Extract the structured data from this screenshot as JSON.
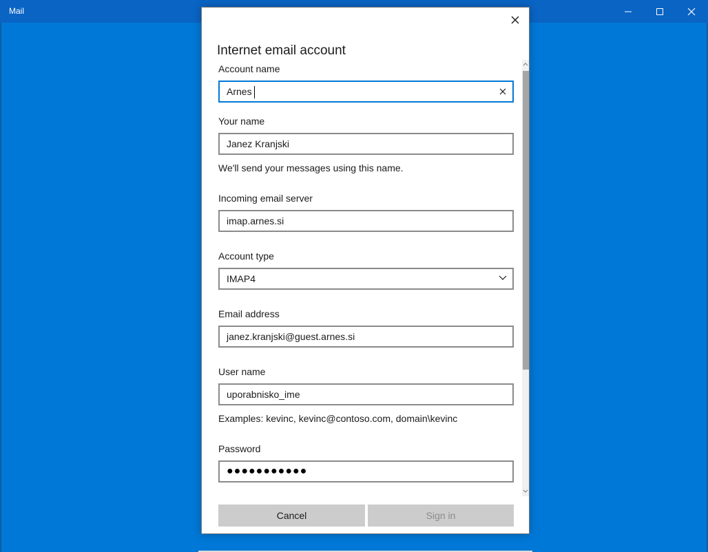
{
  "window": {
    "title": "Mail",
    "minimize_icon": "minimize-icon",
    "maximize_icon": "maximize-icon",
    "close_icon": "close-icon"
  },
  "dialog": {
    "title": "Internet email account",
    "close_icon": "close-icon",
    "fields": {
      "account_name": {
        "label": "Account name",
        "value": "Arnes"
      },
      "your_name": {
        "label": "Your name",
        "value": "Janez Kranjski",
        "hint": "We'll send your messages using this name."
      },
      "incoming_server": {
        "label": "Incoming email server",
        "value": "imap.arnes.si"
      },
      "account_type": {
        "label": "Account type",
        "value": "IMAP4"
      },
      "email_address": {
        "label": "Email address",
        "value": "janez.kranjski@guest.arnes.si"
      },
      "user_name": {
        "label": "User name",
        "value": "uporabnisko_ime",
        "hint": "Examples: kevinc, kevinc@contoso.com, domain\\kevinc"
      },
      "password": {
        "label": "Password",
        "value": "●●●●●●●●●●●"
      }
    },
    "buttons": {
      "cancel": "Cancel",
      "sign_in": "Sign in"
    }
  },
  "colors": {
    "accent": "#0078d7",
    "titlebar": "#0a64c4"
  }
}
